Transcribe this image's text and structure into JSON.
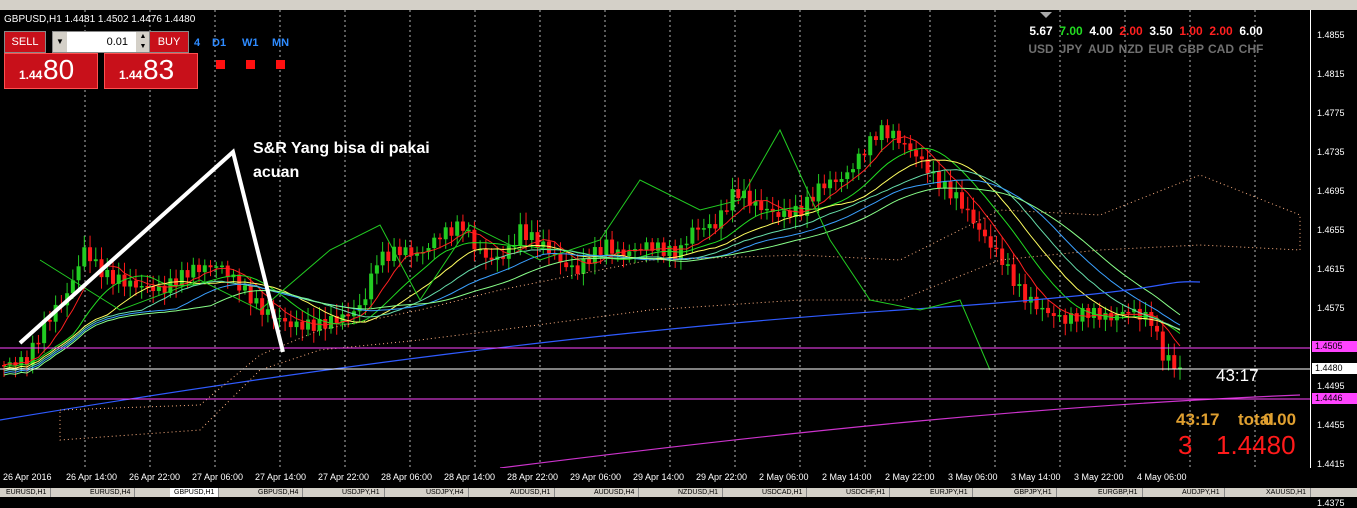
{
  "symbol_header": "GBPUSD,H1 1.4481 1.4502 1.4476 1.4480",
  "trade_panel": {
    "sell_label": "SELL",
    "buy_label": "BUY",
    "lot_value": "0.01",
    "sell_price_small": "1.44",
    "sell_price_big": "80",
    "buy_price_small": "1.44",
    "buy_price_big": "83"
  },
  "timeframes": [
    "4",
    "D1",
    "W1",
    "MN"
  ],
  "currency_strength": [
    {
      "value": "5.67",
      "label": "USD",
      "color": "#ffffff"
    },
    {
      "value": "7.00",
      "label": "JPY",
      "color": "#22dd22"
    },
    {
      "value": "4.00",
      "label": "AUD",
      "color": "#ffffff"
    },
    {
      "value": "2.00",
      "label": "NZD",
      "color": "#ff2020"
    },
    {
      "value": "3.50",
      "label": "EUR",
      "color": "#ffffff"
    },
    {
      "value": "1.00",
      "label": "GBP",
      "color": "#ff2020"
    },
    {
      "value": "2.00",
      "label": "CAD",
      "color": "#ff2020"
    },
    {
      "value": "6.00",
      "label": "CHF",
      "color": "#ffffff"
    }
  ],
  "annotation": {
    "line1": "S&R  Yang bisa di pakai",
    "line2": "acuan"
  },
  "countdown": "43:17",
  "summary": {
    "timer": "43:17",
    "total_label": "total",
    "total_value": "0.00",
    "count": "3",
    "price": "1.4480"
  },
  "price_axis": {
    "labels": [
      "1.4855",
      "1.4815",
      "1.4775",
      "1.4735",
      "1.4695",
      "1.4655",
      "1.4615",
      "1.4575",
      "1.4535",
      "1.4495",
      "1.4455",
      "1.4415",
      "1.4375"
    ],
    "tag_high": "1.4505",
    "tag_current": "1.4480",
    "tag_low": "1.4446"
  },
  "time_axis": [
    "26 Apr 2016",
    "26 Apr 14:00",
    "26 Apr 22:00",
    "27 Apr 06:00",
    "27 Apr 14:00",
    "27 Apr 22:00",
    "28 Apr 06:00",
    "28 Apr 14:00",
    "28 Apr 22:00",
    "29 Apr 06:00",
    "29 Apr 14:00",
    "29 Apr 22:00",
    "2 May 06:00",
    "2 May 14:00",
    "2 May 22:00",
    "3 May 06:00",
    "3 May 14:00",
    "3 May 22:00",
    "4 May 06:00"
  ],
  "tabs": [
    "EURUSD,H1",
    "EURUSD,H4",
    "GBPUSD,H1",
    "GBPUSD,H4",
    "USDJPY,H1",
    "USDJPY,H4",
    "AUDUSD,H1",
    "AUDUSD,H4",
    "NZDUSD,H1",
    "USDCAD,H1",
    "USDCHF,H1",
    "EURJPY,H1",
    "GBPJPY,H1",
    "EURGBP,H1",
    "AUDJPY,H1",
    "XAUUSD,H1"
  ],
  "colors": {
    "bull": "#22cc22",
    "bear": "#ff1a1a",
    "accent": "#c8101a",
    "magenta": "#ff44ff"
  }
}
